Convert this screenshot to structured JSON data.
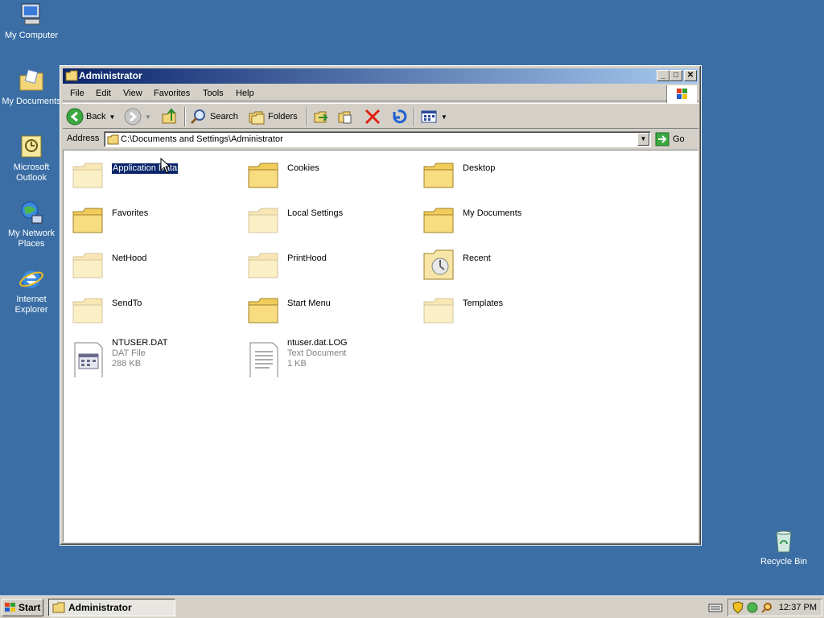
{
  "desktop": {
    "icons": [
      {
        "label": "My Computer",
        "icon": "my-computer-icon"
      },
      {
        "label": "My Documents",
        "icon": "my-documents-icon"
      },
      {
        "label": "Microsoft Outlook",
        "icon": "outlook-icon"
      },
      {
        "label": "My Network Places",
        "icon": "network-places-icon"
      },
      {
        "label": "Internet Explorer",
        "icon": "internet-explorer-icon"
      },
      {
        "label": "Recycle Bin",
        "icon": "recycle-bin-icon"
      }
    ]
  },
  "window": {
    "title": "Administrator",
    "menu": [
      "File",
      "Edit",
      "View",
      "Favorites",
      "Tools",
      "Help"
    ],
    "toolbar": {
      "back_label": "Back",
      "search_label": "Search",
      "folders_label": "Folders"
    },
    "address": {
      "label": "Address",
      "value": "C:\\Documents and Settings\\Administrator",
      "go_label": "Go"
    },
    "items": [
      {
        "name": "Application Data",
        "type": "folder",
        "faded": true,
        "selected": true
      },
      {
        "name": "Cookies",
        "type": "folder",
        "faded": false
      },
      {
        "name": "Desktop",
        "type": "folder",
        "faded": false
      },
      {
        "name": "Favorites",
        "type": "folder",
        "faded": false
      },
      {
        "name": "Local Settings",
        "type": "folder",
        "faded": true
      },
      {
        "name": "My Documents",
        "type": "folder",
        "faded": false
      },
      {
        "name": "NetHood",
        "type": "folder",
        "faded": true
      },
      {
        "name": "PrintHood",
        "type": "folder",
        "faded": true
      },
      {
        "name": "Recent",
        "type": "recent-folder",
        "faded": false
      },
      {
        "name": "SendTo",
        "type": "folder",
        "faded": true
      },
      {
        "name": "Start Menu",
        "type": "folder",
        "faded": false
      },
      {
        "name": "Templates",
        "type": "folder",
        "faded": true
      },
      {
        "name": "NTUSER.DAT",
        "type": "dat-file",
        "kind": "DAT File",
        "size": "288 KB"
      },
      {
        "name": "ntuser.dat.LOG",
        "type": "text-file",
        "kind": "Text Document",
        "size": "1 KB"
      }
    ]
  },
  "taskbar": {
    "start_label": "Start",
    "task_label": "Administrator",
    "clock": "12:37 PM"
  }
}
